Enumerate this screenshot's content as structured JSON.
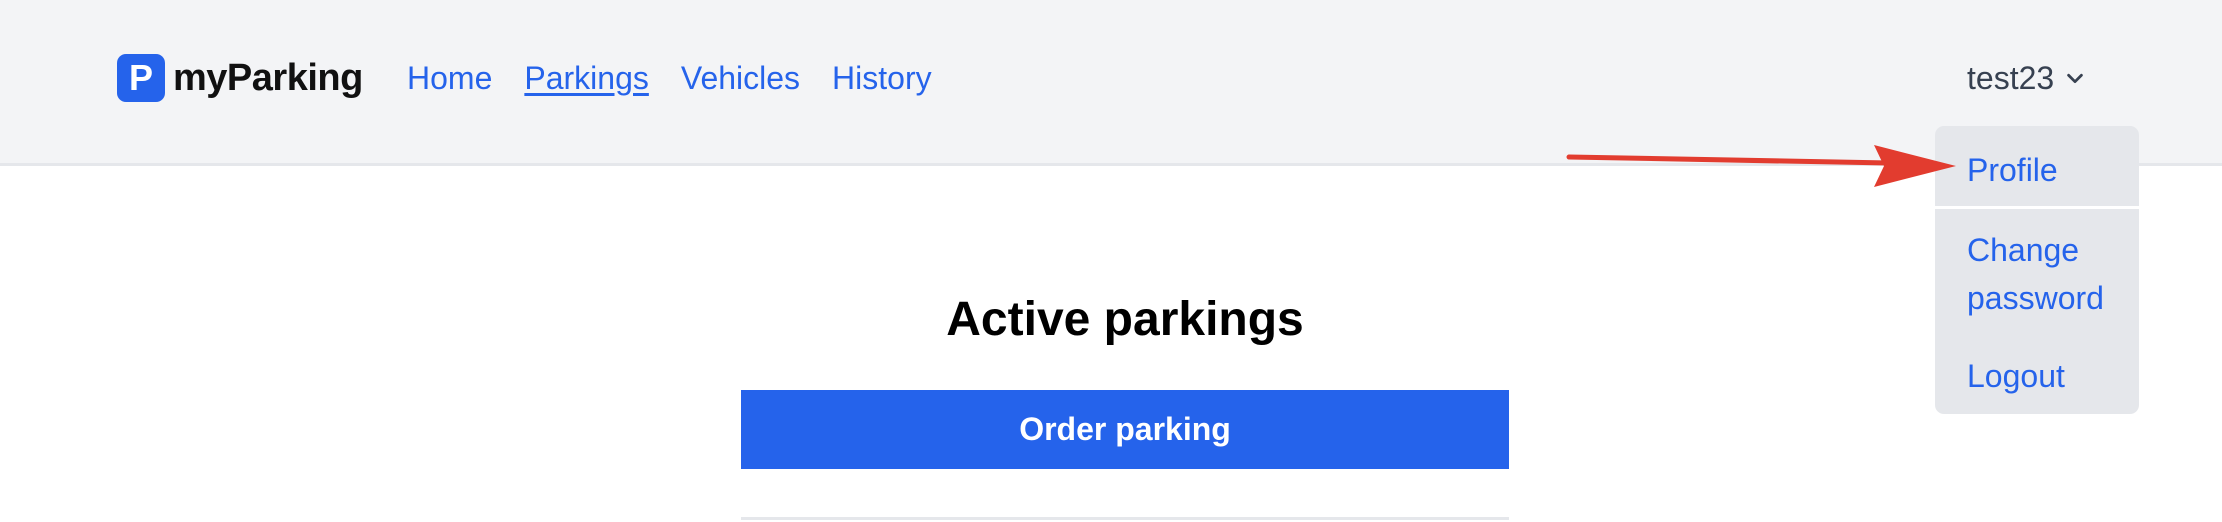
{
  "brand": {
    "logo_letter": "P",
    "name": "myParking",
    "logo_color": "#2563eb"
  },
  "nav": {
    "items": [
      {
        "label": "Home",
        "active": false
      },
      {
        "label": "Parkings",
        "active": true
      },
      {
        "label": "Vehicles",
        "active": false
      },
      {
        "label": "History",
        "active": false
      }
    ]
  },
  "user_menu": {
    "username": "test23",
    "toggle_icon": "chevron-down-icon",
    "expanded": true,
    "items": [
      {
        "label": "Profile",
        "highlighted": true
      },
      {
        "label": "Change password",
        "highlighted": false
      },
      {
        "label": "Logout",
        "highlighted": false
      }
    ]
  },
  "annotation": {
    "icon": "red-arrow-icon",
    "color": "#e23c2f",
    "target": "Profile"
  },
  "main": {
    "title": "Active parkings",
    "order_button_label": "Order parking"
  },
  "colors": {
    "accent": "#2563eb",
    "header_bg": "#f3f4f6",
    "dropdown_bg": "#e5e7eb"
  }
}
